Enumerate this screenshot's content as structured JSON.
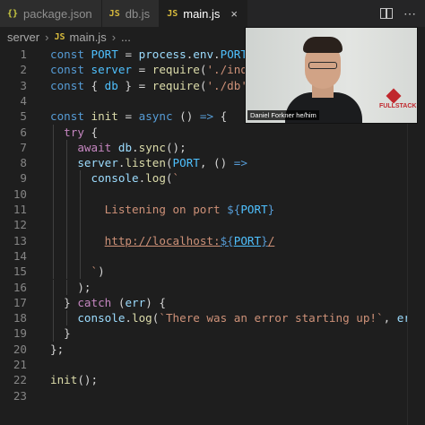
{
  "tabs": [
    {
      "icon": "{}",
      "label": "package.json",
      "active": false
    },
    {
      "icon": "JS",
      "label": "db.js",
      "active": false
    },
    {
      "icon": "JS",
      "label": "main.js",
      "active": true
    }
  ],
  "close_glyph": "×",
  "breadcrumb": {
    "folder": "server",
    "file_icon": "JS",
    "file": "main.js",
    "more": "..."
  },
  "code_lines": [
    {
      "n": "1",
      "html": "<span class='kw'>const</span> <span class='cst'>PORT</span> = <span class='vr'>process</span>.<span class='vr'>env</span>.<span class='cst'>PORT</span> || <span class='str'>3000</span>;"
    },
    {
      "n": "2",
      "html": "<span class='kw'>const</span> <span class='cst'>server</span> = <span class='fn'>require</span>(<span class='str'>'./index'</span>);"
    },
    {
      "n": "3",
      "html": "<span class='kw'>const</span> { <span class='cst'>db</span> } = <span class='fn'>require</span>(<span class='str'>'./db'</span>);"
    },
    {
      "n": "4",
      "html": ""
    },
    {
      "n": "5",
      "html": "<span class='kw'>const</span> <span class='fn'>init</span> = <span class='kw'>async</span> () <span class='kw'>=&gt;</span> {"
    },
    {
      "n": "6",
      "html": "  <span class='ctl'>try</span> {"
    },
    {
      "n": "7",
      "html": "    <span class='ctl'>await</span> <span class='vr'>db</span>.<span class='fn'>sync</span>();"
    },
    {
      "n": "8",
      "html": "    <span class='vr'>server</span>.<span class='fn'>listen</span>(<span class='cst'>PORT</span>, () <span class='kw'>=&gt;</span>"
    },
    {
      "n": "9",
      "html": "      <span class='vr'>console</span>.<span class='fn'>log</span>(<span class='str'>`</span>"
    },
    {
      "n": "10",
      "html": ""
    },
    {
      "n": "11",
      "html": "<span class='str'>        Listening on port </span><span class='tpl'>${</span><span class='cst'>PORT</span><span class='tpl'>}</span>"
    },
    {
      "n": "12",
      "html": ""
    },
    {
      "n": "13",
      "html": "<span class='str'>        <span class='url'>http://localhost:</span></span><span class='tpl url'>${</span><span class='cst url'>PORT</span><span class='tpl url'>}</span><span class='str url'>/</span>"
    },
    {
      "n": "14",
      "html": ""
    },
    {
      "n": "15",
      "html": "<span class='str'>      `</span>)"
    },
    {
      "n": "16",
      "html": "    );"
    },
    {
      "n": "17",
      "html": "  } <span class='ctl'>catch</span> (<span class='vr'>err</span>) {"
    },
    {
      "n": "18",
      "html": "    <span class='vr'>console</span>.<span class='fn'>log</span>(<span class='str'>`There was an error starting up!`</span>, <span class='vr'>err</span>);"
    },
    {
      "n": "19",
      "html": "  }"
    },
    {
      "n": "20",
      "html": "};"
    },
    {
      "n": "21",
      "html": ""
    },
    {
      "n": "22",
      "html": "<span class='fn'>init</span>();"
    },
    {
      "n": "23",
      "html": ""
    }
  ],
  "webcam": {
    "caption": "Daniel Forkner he/him",
    "logo_text": "FULLSTACK"
  }
}
